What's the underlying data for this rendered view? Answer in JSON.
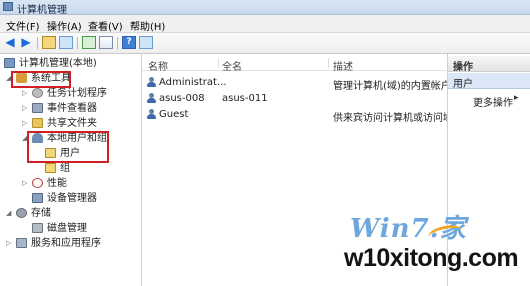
{
  "window": {
    "title": "计算机管理"
  },
  "menu": [
    "文件(F)",
    "操作(A)",
    "查看(V)",
    "帮助(H)"
  ],
  "tree": {
    "root": "计算机管理(本地)",
    "system_tools": "系统工具",
    "task_scheduler": "任务计划程序",
    "event_viewer": "事件查看器",
    "shared_folders": "共享文件夹",
    "local_users_groups": "本地用户和组",
    "users": "用户",
    "groups": "组",
    "performance": "性能",
    "device_manager": "设备管理器",
    "storage": "存储",
    "disk_management": "磁盘管理",
    "services_apps": "服务和应用程序"
  },
  "list": {
    "columns": [
      "名称",
      "全名",
      "描述"
    ],
    "rows": [
      {
        "name": "Administrat...",
        "fullname": "",
        "desc": "管理计算机(域)的内置帐户"
      },
      {
        "name": "asus-008",
        "fullname": "asus-011",
        "desc": ""
      },
      {
        "name": "Guest",
        "fullname": "",
        "desc": "供来宾访问计算机或访问域"
      }
    ]
  },
  "actions": {
    "header": "操作",
    "section": "用户",
    "more": "更多操作",
    "more_arrow": "▸"
  },
  "watermark": {
    "logo": "Win7.家",
    "url": "w10xitong.com"
  },
  "colors": {
    "highlight": "#d21f24",
    "accent": "#3e6aa8"
  }
}
